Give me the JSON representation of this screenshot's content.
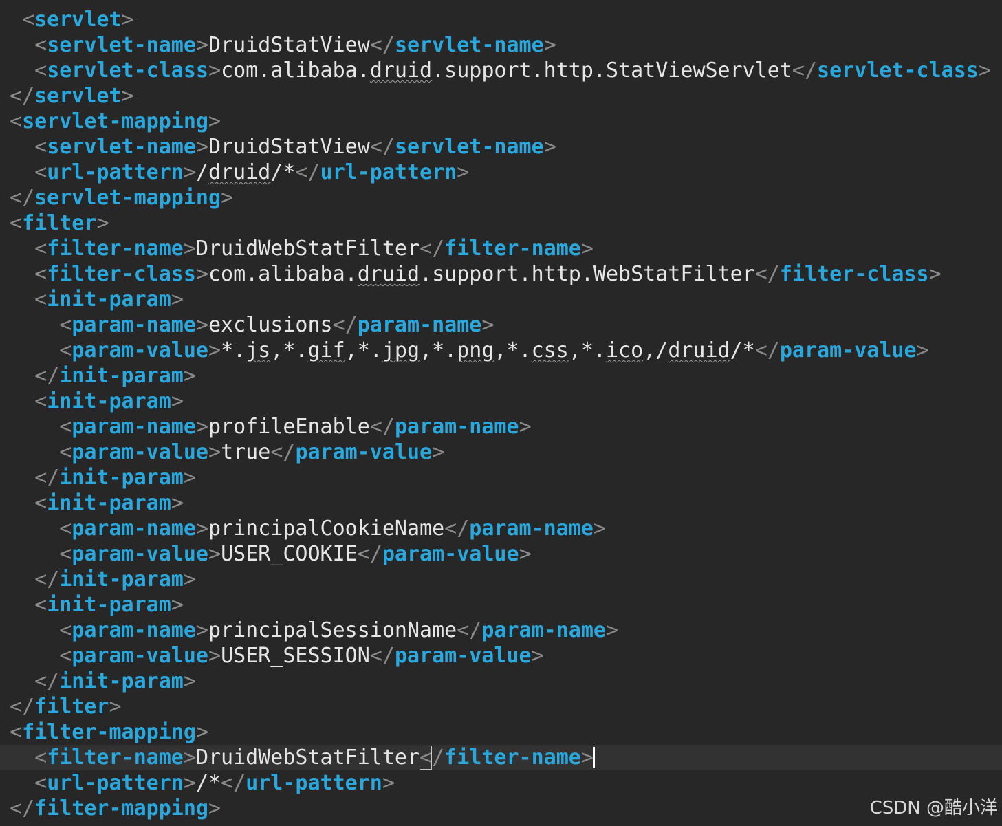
{
  "editor": {
    "language": "xml",
    "lines": [
      {
        "indent": 1,
        "open": "servlet",
        "text": "",
        "close": ""
      },
      {
        "indent": 2,
        "open": "servlet-name",
        "text": "DruidStatView",
        "close": "servlet-name"
      },
      {
        "indent": 2,
        "open": "servlet-class",
        "text": "com.alibaba.druid.support.http.StatViewServlet",
        "close": "servlet-class"
      },
      {
        "indent": 0,
        "open": "",
        "text": "",
        "close": "servlet"
      },
      {
        "indent": 0,
        "open": "servlet-mapping",
        "text": "",
        "close": ""
      },
      {
        "indent": 2,
        "open": "servlet-name",
        "text": "DruidStatView",
        "close": "servlet-name"
      },
      {
        "indent": 2,
        "open": "url-pattern",
        "text": "/druid/*",
        "close": "url-pattern"
      },
      {
        "indent": 0,
        "open": "",
        "text": "",
        "close": "servlet-mapping"
      },
      {
        "indent": 0,
        "open": "filter",
        "text": "",
        "close": ""
      },
      {
        "indent": 2,
        "open": "filter-name",
        "text": "DruidWebStatFilter",
        "close": "filter-name"
      },
      {
        "indent": 2,
        "open": "filter-class",
        "text": "com.alibaba.druid.support.http.WebStatFilter",
        "close": "filter-class"
      },
      {
        "indent": 2,
        "open": "init-param",
        "text": "",
        "close": ""
      },
      {
        "indent": 4,
        "open": "param-name",
        "text": "exclusions",
        "close": "param-name"
      },
      {
        "indent": 4,
        "open": "param-value",
        "text": "*.js,*.gif,*.jpg,*.png,*.css,*.ico,/druid/*",
        "close": "param-value"
      },
      {
        "indent": 2,
        "open": "",
        "text": "",
        "close": "init-param"
      },
      {
        "indent": 2,
        "open": "init-param",
        "text": "",
        "close": ""
      },
      {
        "indent": 4,
        "open": "param-name",
        "text": "profileEnable",
        "close": "param-name"
      },
      {
        "indent": 4,
        "open": "param-value",
        "text": "true",
        "close": "param-value"
      },
      {
        "indent": 2,
        "open": "",
        "text": "",
        "close": "init-param"
      },
      {
        "indent": 2,
        "open": "init-param",
        "text": "",
        "close": ""
      },
      {
        "indent": 4,
        "open": "param-name",
        "text": "principalCookieName",
        "close": "param-name"
      },
      {
        "indent": 4,
        "open": "param-value",
        "text": "USER_COOKIE",
        "close": "param-value"
      },
      {
        "indent": 2,
        "open": "",
        "text": "",
        "close": "init-param"
      },
      {
        "indent": 2,
        "open": "init-param",
        "text": "",
        "close": ""
      },
      {
        "indent": 4,
        "open": "param-name",
        "text": "principalSessionName",
        "close": "param-name"
      },
      {
        "indent": 4,
        "open": "param-value",
        "text": "USER_SESSION",
        "close": "param-value"
      },
      {
        "indent": 2,
        "open": "",
        "text": "",
        "close": "init-param"
      },
      {
        "indent": 0,
        "open": "",
        "text": "",
        "close": "filter"
      },
      {
        "indent": 0,
        "open": "filter-mapping",
        "text": "",
        "close": ""
      },
      {
        "indent": 2,
        "open": "filter-name",
        "text": "DruidWebStatFilter",
        "close": "filter-name",
        "current": true
      },
      {
        "indent": 2,
        "open": "url-pattern",
        "text": "/*",
        "close": "url-pattern"
      },
      {
        "indent": 0,
        "open": "",
        "text": "",
        "close": "filter-mapping"
      }
    ],
    "spellcheck_words": [
      "druid",
      "js",
      "gif",
      "jpg",
      "png",
      "css",
      "ico"
    ]
  },
  "colors": {
    "background": "#272727",
    "current_line": "#323232",
    "tag": "#2aa7dc",
    "angle_bracket": "#8a8a8a",
    "text": "#e6e6e6"
  },
  "watermark": "CSDN @酷小洋"
}
